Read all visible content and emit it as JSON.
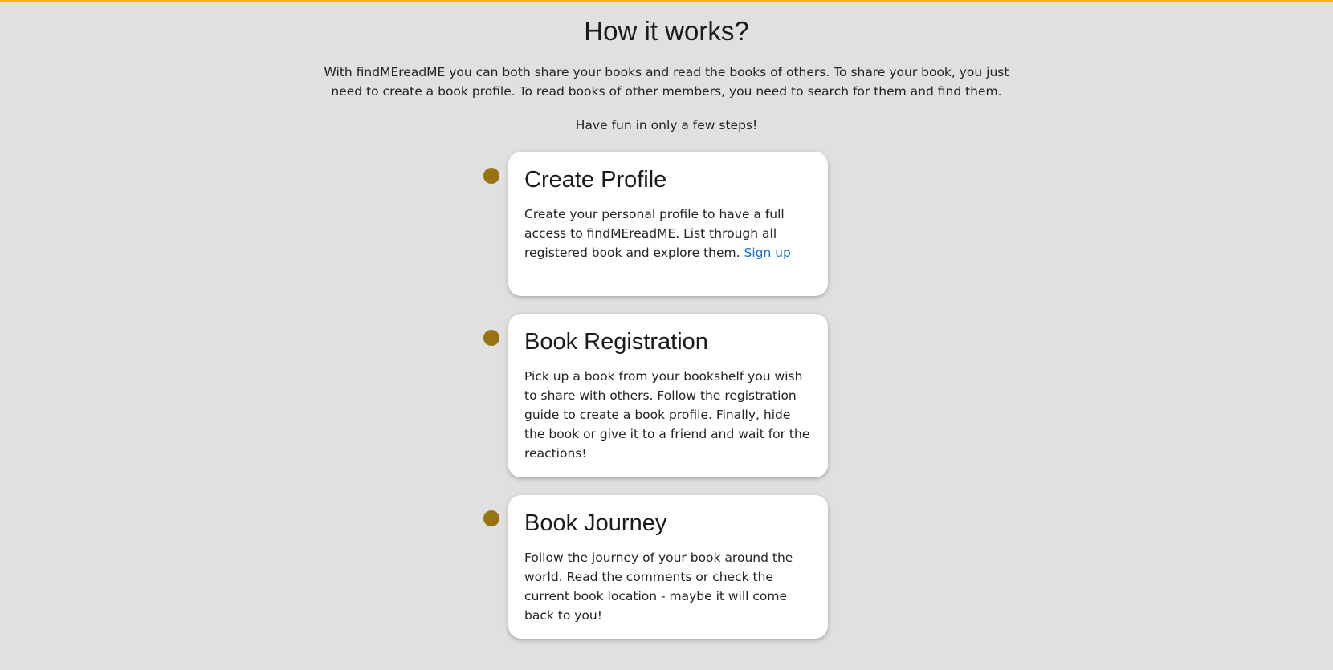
{
  "colors": {
    "background": "#e0e0e0",
    "top_bar": "#f5b800",
    "timeline": "#987312",
    "link": "#1a6fd6",
    "card_bg": "#ffffff"
  },
  "header": {
    "title": "How it works?",
    "intro": "With findMEreadME you can both share your books and read the books of others. To share your book, you just need to create a book profile. To read books of other members, you need to search for them and find them.",
    "subtitle": "Have fun in only a few steps!"
  },
  "steps": [
    {
      "title": "Create Profile",
      "text": "Create your personal profile to have a full access to findMEreadME. List through all registered book and explore them.",
      "link_label": "Sign up"
    },
    {
      "title": "Book Registration",
      "text": "Pick up a book from your bookshelf you wish to share with others. Follow the registration guide to create a book profile. Finally, hide the book or give it to a friend and wait for the reactions!"
    },
    {
      "title": "Book Journey",
      "text": "Follow the journey of your book around the world. Read the comments or check the current book location - maybe it will come back to you!"
    }
  ]
}
